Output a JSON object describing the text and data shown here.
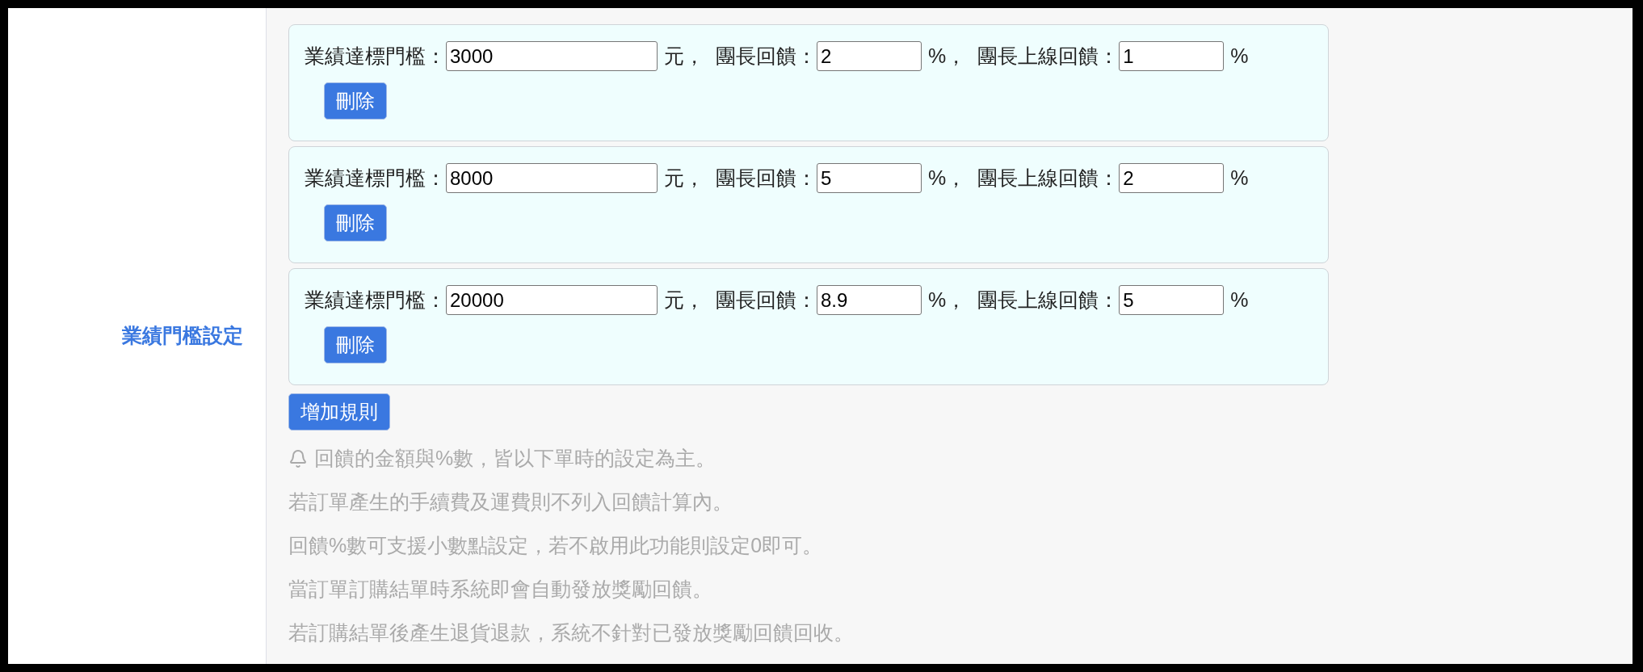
{
  "section_label": "業績門檻設定",
  "rules": [
    {
      "fields": [
        {
          "label": "業績達標門檻：",
          "value": "3000",
          "unit": "元，",
          "kind": "wide"
        },
        {
          "label": "團長回饋：",
          "value": "2",
          "unit": "%，",
          "kind": "narrow"
        },
        {
          "label": "團長上線回饋：",
          "value": "1",
          "unit": "%",
          "kind": "narrow"
        }
      ],
      "delete_button": "刪除"
    },
    {
      "fields": [
        {
          "label": "業績達標門檻：",
          "value": "8000",
          "unit": "元，",
          "kind": "wide"
        },
        {
          "label": "團長回饋：",
          "value": "5",
          "unit": "%，",
          "kind": "narrow"
        },
        {
          "label": "團長上線回饋：",
          "value": "2",
          "unit": "%",
          "kind": "narrow"
        }
      ],
      "delete_button": "刪除"
    },
    {
      "fields": [
        {
          "label": "業績達標門檻：",
          "value": "20000",
          "unit": "元，",
          "kind": "wide"
        },
        {
          "label": "團長回饋：",
          "value": "8.9",
          "unit": "%，",
          "kind": "narrow"
        },
        {
          "label": "團長上線回饋：",
          "value": "5",
          "unit": "%",
          "kind": "narrow"
        }
      ],
      "delete_button": "刪除"
    }
  ],
  "add_button": "增加規則",
  "notes": [
    {
      "text": "回饋的金額與%數，皆以下單時的設定為主。",
      "bell": true
    },
    {
      "text": "若訂單產生的手續費及運費則不列入回饋計算內。",
      "bell": false
    },
    {
      "text": "回饋%數可支援小數點設定，若不啟用此功能則設定0即可。",
      "bell": false
    },
    {
      "text": "當訂單訂購結單時系統即會自動發放獎勵回饋。",
      "bell": false
    },
    {
      "text": "若訂購結單後產生退貨退款，系統不針對已發放獎勵回饋回收。",
      "bell": false
    }
  ]
}
